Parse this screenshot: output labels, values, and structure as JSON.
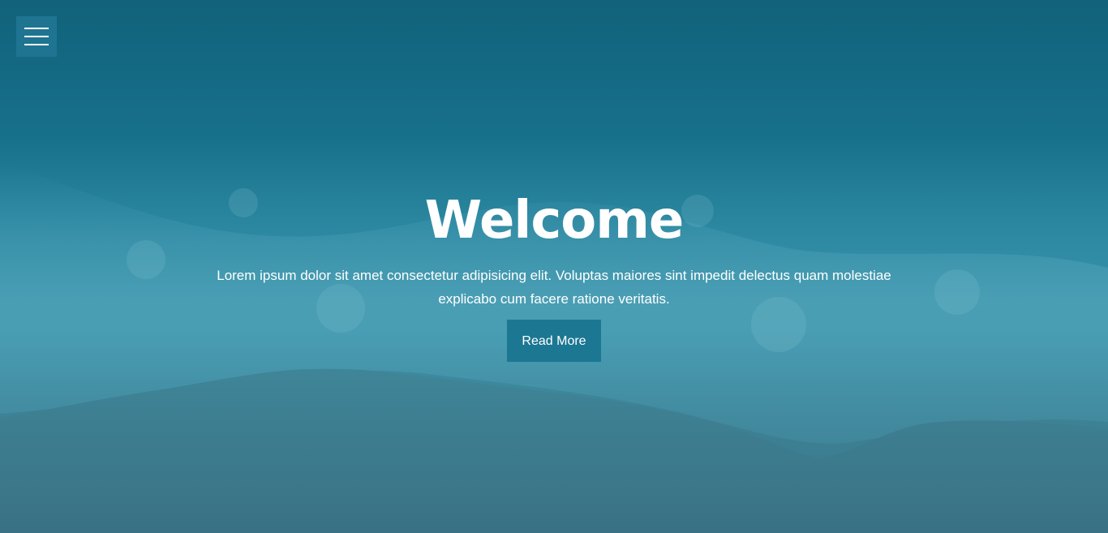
{
  "menu": {
    "icon": "hamburger-menu-icon"
  },
  "hero": {
    "title": "Welcome",
    "description": "Lorem ipsum dolor sit amet consectetur adipisicing elit. Voluptas maiores sint impedit delectus quam molestiae explicabo cum facere ratione veritatis.",
    "button_label": "Read More"
  },
  "colors": {
    "overlay_top": "#11627a",
    "overlay_bottom": "#3b7588",
    "button_bg": "#1c7792",
    "menu_bg": "#1f7492",
    "text": "#ffffff"
  }
}
